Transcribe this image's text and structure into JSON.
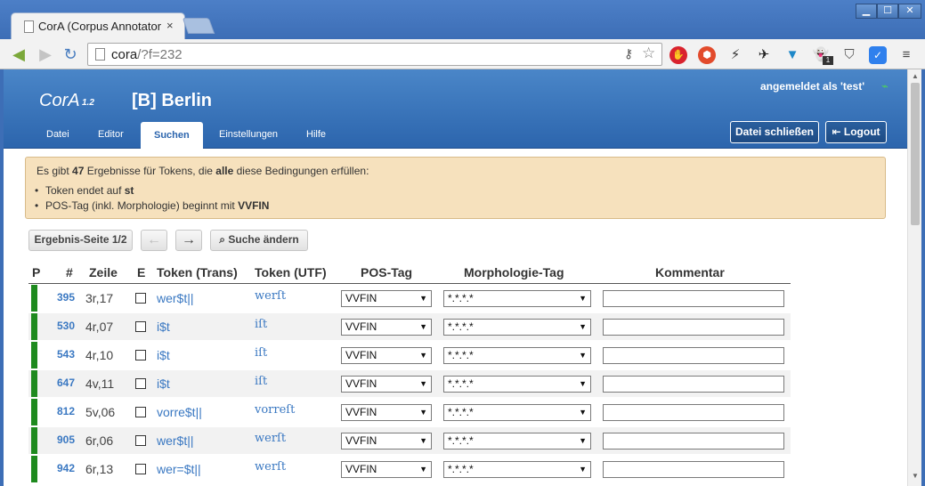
{
  "browser": {
    "tab_title": "CorA (Corpus Annotator",
    "tab_close": "×",
    "url_host": "cora",
    "url_rest": "/?f=232"
  },
  "app": {
    "logo": "CorA",
    "version": "1.2",
    "file_title": "[B] Berlin",
    "user_info": "angemeldet als 'test'",
    "tabs": [
      "Datei",
      "Editor",
      "Suchen",
      "Einstellungen",
      "Hilfe"
    ],
    "active_tab": "Suchen",
    "close_file_label": "Datei schließen",
    "logout_label": "Logout"
  },
  "info": {
    "prefix": "Es gibt ",
    "count": "47",
    "middle": " Ergebnisse für Tokens, die ",
    "all_word": "alle",
    "suffix": " diese Bedingungen erfüllen:",
    "cond1_prefix": "Token endet auf ",
    "cond1_value": "st",
    "cond2_prefix": "POS-Tag (inkl. Morphologie) beginnt mit ",
    "cond2_value": "VVFIN"
  },
  "pager": {
    "page_label": "Ergebnis-Seite 1/2",
    "prev": "←",
    "next": "→",
    "change_search": "Suche ändern"
  },
  "table": {
    "headers": [
      "P",
      "#",
      "Zeile",
      "E",
      "Token (Trans)",
      "Token (UTF)",
      "POS-Tag",
      "Morphologie-Tag",
      "Kommentar"
    ],
    "rows": [
      {
        "num": "395",
        "zeile": "3r,17",
        "trans": "wer$t||",
        "utf": "werſt",
        "pos": "VVFIN",
        "morph": "*.*.*.*"
      },
      {
        "num": "530",
        "zeile": "4r,07",
        "trans": "i$t",
        "utf": "iſt",
        "pos": "VVFIN",
        "morph": "*.*.*.*"
      },
      {
        "num": "543",
        "zeile": "4r,10",
        "trans": "i$t",
        "utf": "iſt",
        "pos": "VVFIN",
        "morph": "*.*.*.*"
      },
      {
        "num": "647",
        "zeile": "4v,11",
        "trans": "i$t",
        "utf": "iſt",
        "pos": "VVFIN",
        "morph": "*.*.*.*"
      },
      {
        "num": "812",
        "zeile": "5v,06",
        "trans": "vorre$t||",
        "utf": "vorreſt",
        "pos": "VVFIN",
        "morph": "*.*.*.*"
      },
      {
        "num": "905",
        "zeile": "6r,06",
        "trans": "wer$t||",
        "utf": "werſt",
        "pos": "VVFIN",
        "morph": "*.*.*.*"
      },
      {
        "num": "942",
        "zeile": "6r,13",
        "trans": "wer=$t||",
        "utf": "werſt",
        "pos": "VVFIN",
        "morph": "*.*.*.*"
      }
    ]
  },
  "colors": {
    "header_blue": "#2c65ad",
    "link_blue": "#3a78c2",
    "row_marker_green": "#1e8a1e",
    "info_bg": "#f6e1bd"
  }
}
